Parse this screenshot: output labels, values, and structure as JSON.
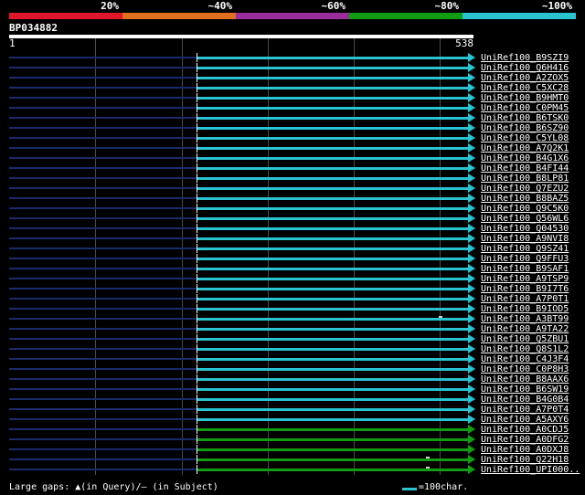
{
  "identity_scale": {
    "labels": [
      "20%",
      "~40%",
      "~60%",
      "~80%",
      "~100%"
    ],
    "colors": [
      "#e0162b",
      "#e07020",
      "#9c2d9c",
      "#129c12",
      "#29c3d2"
    ]
  },
  "query": {
    "id": "BP034882",
    "start": "1",
    "end": "538"
  },
  "hits": [
    {
      "label": "UniRef100_B9SZI9",
      "color": "#29c3d2"
    },
    {
      "label": "UniRef100_Q6H416",
      "color": "#29c3d2"
    },
    {
      "label": "UniRef100_A2ZOX5",
      "color": "#29c3d2"
    },
    {
      "label": "UniRef100_C5XC28",
      "color": "#29c3d2"
    },
    {
      "label": "UniRef100_B9HMT0",
      "color": "#29c3d2"
    },
    {
      "label": "UniRef100_C0PM45",
      "color": "#29c3d2"
    },
    {
      "label": "UniRef100_B6TSK0",
      "color": "#29c3d2"
    },
    {
      "label": "UniRef100_B6SZ90",
      "color": "#29c3d2"
    },
    {
      "label": "UniRef100_C5YL08",
      "color": "#29c3d2"
    },
    {
      "label": "UniRef100_A7Q2K1",
      "color": "#29c3d2"
    },
    {
      "label": "UniRef100_B4G1X6",
      "color": "#29c3d2"
    },
    {
      "label": "UniRef100_B4FI44",
      "color": "#29c3d2"
    },
    {
      "label": "UniRef100_B8LP81",
      "color": "#29c3d2"
    },
    {
      "label": "UniRef100_Q7EZU2",
      "color": "#29c3d2"
    },
    {
      "label": "UniRef100_B8BAZ5",
      "color": "#29c3d2"
    },
    {
      "label": "UniRef100_Q9C5K0",
      "color": "#29c3d2"
    },
    {
      "label": "UniRef100_Q56WL6",
      "color": "#29c3d2"
    },
    {
      "label": "UniRef100_Q04530",
      "color": "#29c3d2"
    },
    {
      "label": "UniRef100_A9NVI8",
      "color": "#29c3d2"
    },
    {
      "label": "UniRef100_Q9SZ41",
      "color": "#29c3d2"
    },
    {
      "label": "UniRef100_Q9FFU3",
      "color": "#29c3d2"
    },
    {
      "label": "UniRef100_B9SAF1",
      "color": "#29c3d2"
    },
    {
      "label": "UniRef100_A9TSP9",
      "color": "#29c3d2"
    },
    {
      "label": "UniRef100_B9I7T6",
      "color": "#29c3d2"
    },
    {
      "label": "UniRef100_A7P0T1",
      "color": "#29c3d2"
    },
    {
      "label": "UniRef100_B9IOD5",
      "color": "#29c3d2"
    },
    {
      "label": "UniRef100_A3BT99",
      "color": "#29c3d2"
    },
    {
      "label": "UniRef100_A9TA22",
      "color": "#29c3d2"
    },
    {
      "label": "UniRef100_Q5ZBU1",
      "color": "#29c3d2"
    },
    {
      "label": "UniRef100_Q8S1L2",
      "color": "#29c3d2"
    },
    {
      "label": "UniRef100_C4J3F4",
      "color": "#29c3d2"
    },
    {
      "label": "UniRef100_C0P8H3",
      "color": "#29c3d2"
    },
    {
      "label": "UniRef100_B8AAX6",
      "color": "#29c3d2"
    },
    {
      "label": "UniRef100_B6SW19",
      "color": "#29c3d2"
    },
    {
      "label": "UniRef100_B4G0B4",
      "color": "#29c3d2"
    },
    {
      "label": "UniRef100_A7P0T4",
      "color": "#29c3d2"
    },
    {
      "label": "UniRef100_A5AXY6",
      "color": "#29c3d2"
    },
    {
      "label": "UniRef100_A0CDJ5",
      "color": "#129c12"
    },
    {
      "label": "UniRef100_A0DFG2",
      "color": "#129c12"
    },
    {
      "label": "UniRef100_A0DXJ8",
      "color": "#129c12"
    },
    {
      "label": "UniRef100_Q22H18",
      "color": "#129c12"
    },
    {
      "label": "UniRef100_UPI000..",
      "color": "#129c12"
    }
  ],
  "footer": {
    "text": "Large gaps: ▲(in Query)/— (in Subject)",
    "scale_legend": "=100char."
  }
}
